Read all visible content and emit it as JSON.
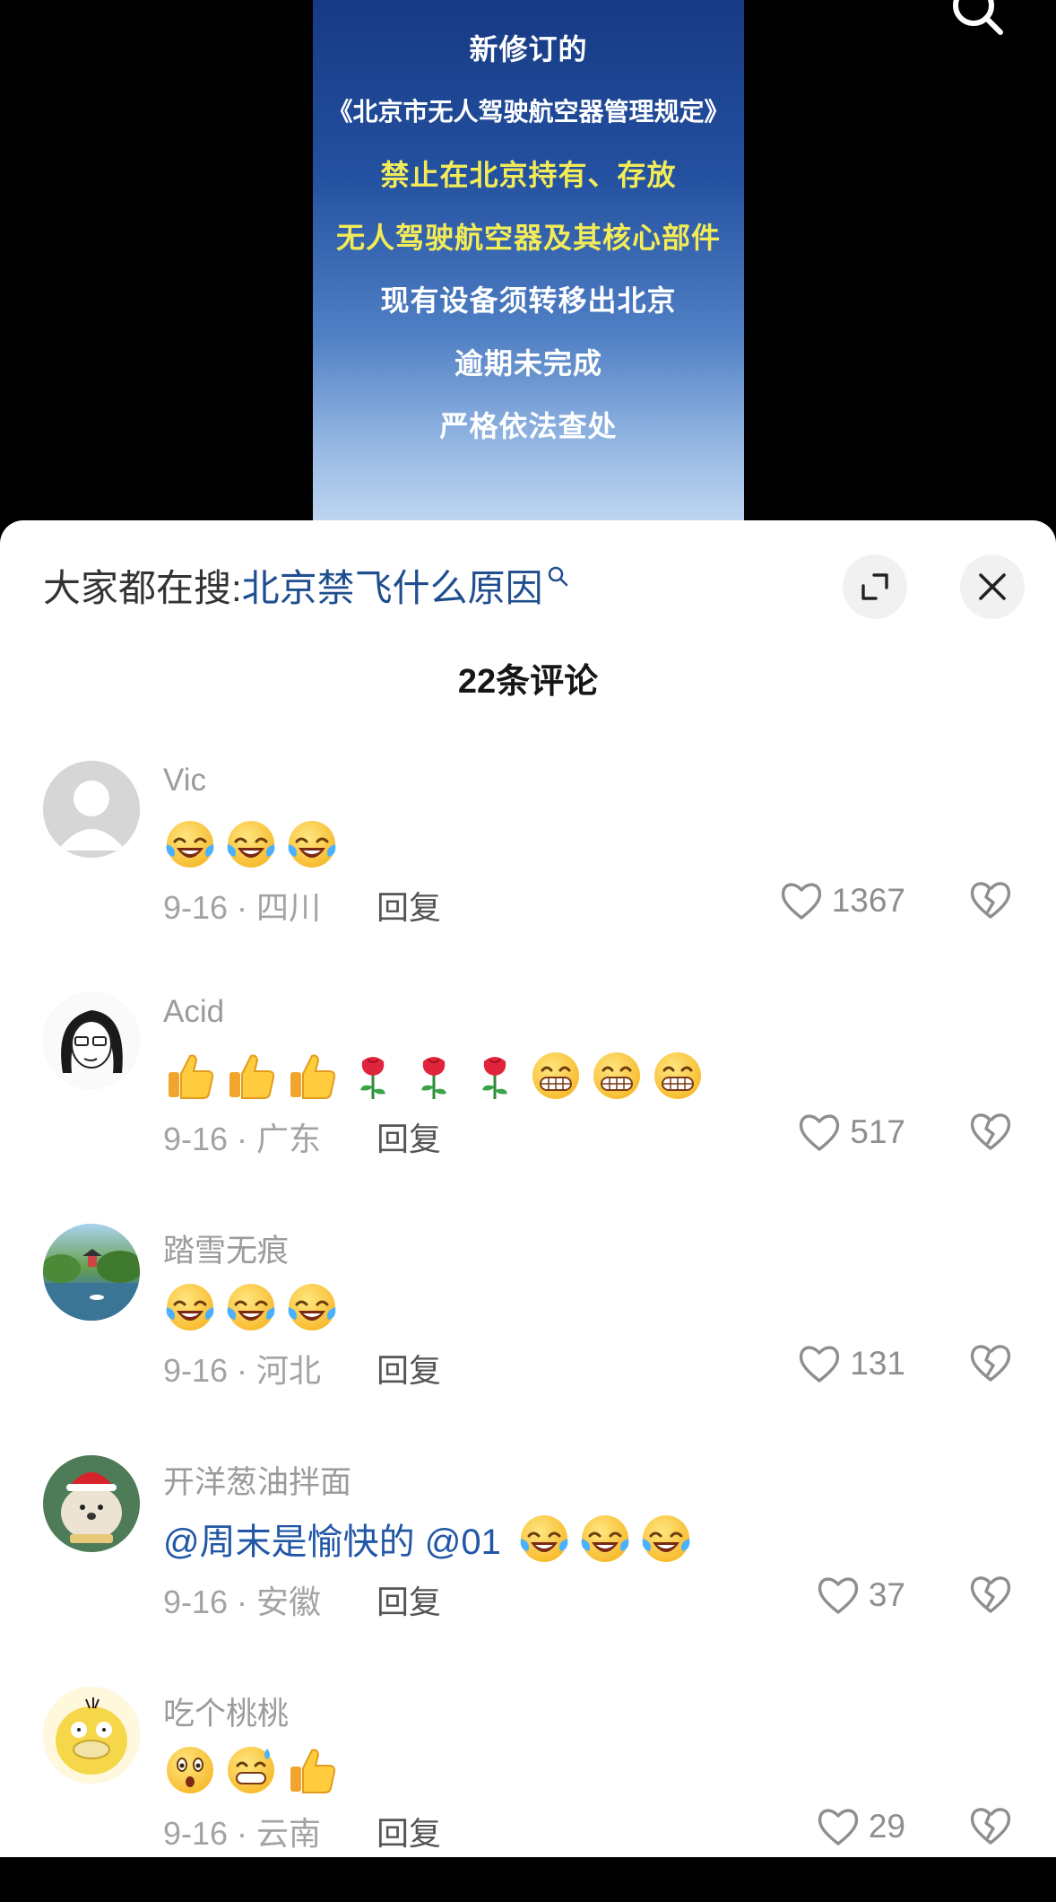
{
  "video": {
    "poster_lines": [
      "新修订的",
      "《北京市无人驾驶航空器管理规定》",
      "禁止在北京持有、存放",
      "无人驾驶航空器及其核心部件",
      "现有设备须转移出北京",
      "逾期未完成",
      "严格依法查处"
    ]
  },
  "sheet": {
    "hot_search_label": "大家都在搜:",
    "hot_search_term": "北京禁飞什么原因",
    "comment_count": "22条评论",
    "reply_label": "回复"
  },
  "comments": [
    {
      "author": "Vic",
      "mention": "",
      "emojis": [
        "laugh-cry",
        "laugh-cry",
        "laugh-cry"
      ],
      "meta": "9-16 · 四川",
      "likes": "1367",
      "avatar": "default-avatar"
    },
    {
      "author": "Acid",
      "mention": "",
      "emojis": [
        "thumbs-up",
        "thumbs-up",
        "thumbs-up",
        "rose",
        "rose",
        "rose",
        "grin",
        "grin",
        "grin"
      ],
      "meta": "9-16 · 广东",
      "likes": "517",
      "avatar": "sketch-girl-avatar"
    },
    {
      "author": "踏雪无痕",
      "mention": "",
      "emojis": [
        "laugh-cry",
        "laugh-cry",
        "laugh-cry"
      ],
      "meta": "9-16 · 河北",
      "likes": "131",
      "avatar": "landscape-avatar"
    },
    {
      "author": "开洋葱油拌面",
      "mention": "@周末是愉快的 @01",
      "emojis": [
        "laugh-cry",
        "laugh-cry",
        "laugh-cry"
      ],
      "meta": "9-16 · 安徽",
      "likes": "37",
      "avatar": "christmas-dog-avatar"
    },
    {
      "author": "吃个桃桃",
      "mention": "",
      "emojis": [
        "surprised",
        "sweat-grin",
        "thumbs-up"
      ],
      "meta": "9-16 · 云南",
      "likes": "29",
      "avatar": "yellow-duck-avatar"
    }
  ]
}
